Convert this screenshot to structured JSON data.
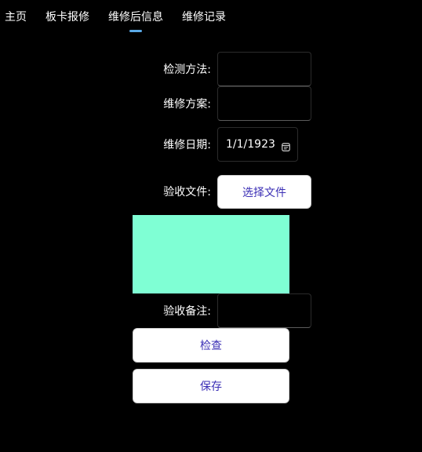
{
  "tabs": [
    {
      "label": "主页"
    },
    {
      "label": "板卡报修"
    },
    {
      "label": "维修后信息",
      "active": true
    },
    {
      "label": "维修记录"
    }
  ],
  "form": {
    "method_label": "检测方法:",
    "method_value": "",
    "plan_label": "维修方案:",
    "plan_value": "",
    "date_label": "维修日期:",
    "date_value": "1/1/1923",
    "file_label": "验收文件:",
    "file_button": "选择文件",
    "note_label": "验收备注:",
    "note_value": ""
  },
  "actions": {
    "check_label": "检查",
    "save_label": "保存"
  },
  "colors": {
    "background": "#000000",
    "accent": "#5aa9e6",
    "preview": "#7fffd4",
    "button_text": "#3b2fb5"
  }
}
